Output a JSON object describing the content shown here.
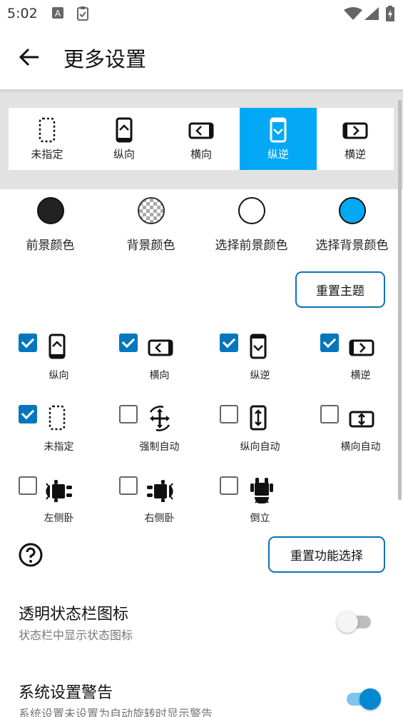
{
  "status_bar": {
    "time": "5:02",
    "icons": [
      "notification-a-icon",
      "clipboard-icon",
      "wifi-icon",
      "signal-icon",
      "battery-charging-icon"
    ]
  },
  "app_bar": {
    "title": "更多设置",
    "back_icon": "arrow-back-icon"
  },
  "orientation_tabs": {
    "selected_index": 3,
    "accent_color": "#03a9f4",
    "items": [
      {
        "label": "未指定",
        "icon": "unspecified-icon"
      },
      {
        "label": "纵向",
        "icon": "portrait-icon"
      },
      {
        "label": "横向",
        "icon": "landscape-icon"
      },
      {
        "label": "纵逆",
        "icon": "reverse-portrait-icon"
      },
      {
        "label": "横逆",
        "icon": "reverse-landscape-icon"
      }
    ]
  },
  "theme_colors": {
    "items": [
      {
        "label": "前景颜色",
        "color": "#222222"
      },
      {
        "label": "背景颜色",
        "color": "checkerboard"
      },
      {
        "label": "选择前景颜色",
        "color": "#ffffff"
      },
      {
        "label": "选择背景颜色",
        "color": "#03a9f4"
      }
    ],
    "reset_button": "重置主题"
  },
  "functions": {
    "items": [
      {
        "label": "纵向",
        "checked": true,
        "icon": "portrait-icon"
      },
      {
        "label": "横向",
        "checked": true,
        "icon": "landscape-icon"
      },
      {
        "label": "纵逆",
        "checked": true,
        "icon": "reverse-portrait-icon"
      },
      {
        "label": "横逆",
        "checked": true,
        "icon": "reverse-landscape-icon"
      },
      {
        "label": "未指定",
        "checked": true,
        "icon": "unspecified-icon"
      },
      {
        "label": "强制自动",
        "checked": false,
        "icon": "force-auto-icon"
      },
      {
        "label": "纵向自动",
        "checked": false,
        "icon": "portrait-auto-icon"
      },
      {
        "label": "横向自动",
        "checked": false,
        "icon": "landscape-auto-icon"
      },
      {
        "label": "左侧卧",
        "checked": false,
        "icon": "android-left-icon"
      },
      {
        "label": "右侧卧",
        "checked": false,
        "icon": "android-right-icon"
      },
      {
        "label": "倒立",
        "checked": false,
        "icon": "android-upside-down-icon"
      }
    ],
    "reset_button": "重置功能选择",
    "help_icon": "help-icon"
  },
  "preferences": [
    {
      "title": "透明状态栏图标",
      "subtitle": "状态栏中显示状态图标",
      "enabled": false
    },
    {
      "title": "系统设置警告",
      "subtitle": "系统设置未设置为自动旋转时显示警告",
      "enabled": true
    }
  ]
}
